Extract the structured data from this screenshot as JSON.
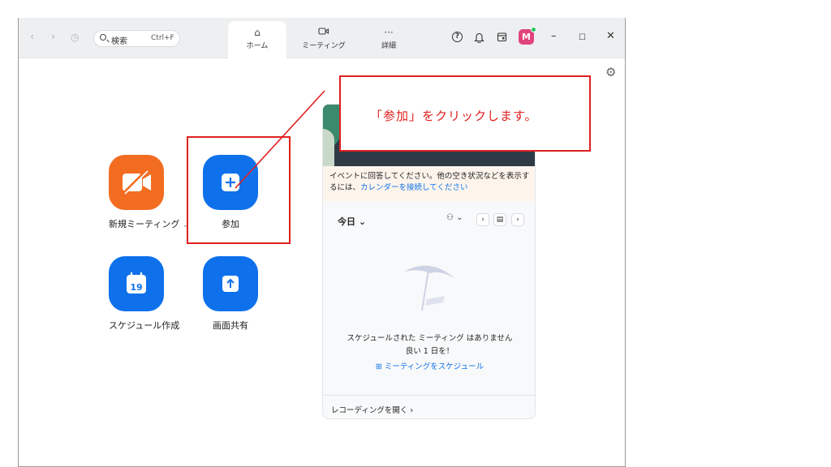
{
  "titlebar": {
    "search": {
      "label": "検索",
      "shortcut": "Ctrl+F"
    },
    "tabs": [
      {
        "label": "ホーム",
        "icon": "home-icon",
        "active": true
      },
      {
        "label": "ミーティング",
        "icon": "video-icon",
        "active": false
      },
      {
        "label": "詳細",
        "icon": "more-icon",
        "active": false
      }
    ],
    "avatar_initial": "M"
  },
  "actions": [
    {
      "label": "新規ミーティング",
      "icon": "video-off-icon",
      "color": "#f26d21"
    },
    {
      "label": "参加",
      "icon": "plus-icon",
      "color": "#0e71eb"
    },
    {
      "label": "スケジュール作成",
      "icon": "calendar-icon",
      "color": "#0e71eb",
      "day": "19"
    },
    {
      "label": "画面共有",
      "icon": "share-up-arrow-icon",
      "color": "#0e71eb"
    }
  ],
  "panel": {
    "notice_text": "イベントに回答してください。他の空き状況などを表示するには、",
    "notice_link": "カレンダーを接続してください",
    "today_label": "今日",
    "empty_line1": "スケジュールされた ミーティング はありません",
    "empty_line2": "良い 1 日を！",
    "schedule_link": "ミーティングをスケジュール",
    "recording_link": "レコーディングを開く"
  },
  "annotation": {
    "callout_text": "「参加」をクリックします。",
    "color": "#e02020"
  }
}
